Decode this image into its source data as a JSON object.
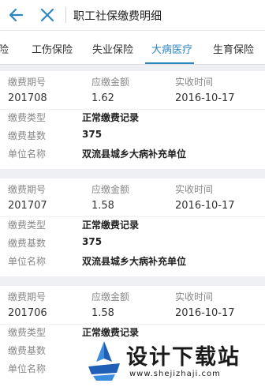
{
  "header": {
    "title": "职工社保缴费明细"
  },
  "tabs": [
    {
      "label": "险"
    },
    {
      "label": "工伤保险"
    },
    {
      "label": "失业保险"
    },
    {
      "label": "大病医疗",
      "active": true
    },
    {
      "label": "生育保险"
    }
  ],
  "columns": {
    "period": "缴费期号",
    "due": "应缴金额",
    "received": "实收时间",
    "type": "缴费类型",
    "base": "缴费基数",
    "unit": "单位名称"
  },
  "records": [
    {
      "period": "201708",
      "due": "1.62",
      "received": "2016-10-17",
      "type": "正常缴费记录",
      "base": "375",
      "unit": "双流县城乡大病补充单位"
    },
    {
      "period": "201707",
      "due": "1.58",
      "received": "2016-10-17",
      "type": "正常缴费记录",
      "base": "375",
      "unit": "双流县城乡大病补充单位"
    },
    {
      "period": "201706",
      "due": "1.58",
      "received": "2016-10-17",
      "type": "正常缴费记录",
      "base": "",
      "unit": ""
    }
  ],
  "watermark": {
    "brand": "设计下载站",
    "url": "www.shejizhaji.com"
  },
  "colors": {
    "accent": "#2e86c1",
    "background": "#eef0f3"
  }
}
